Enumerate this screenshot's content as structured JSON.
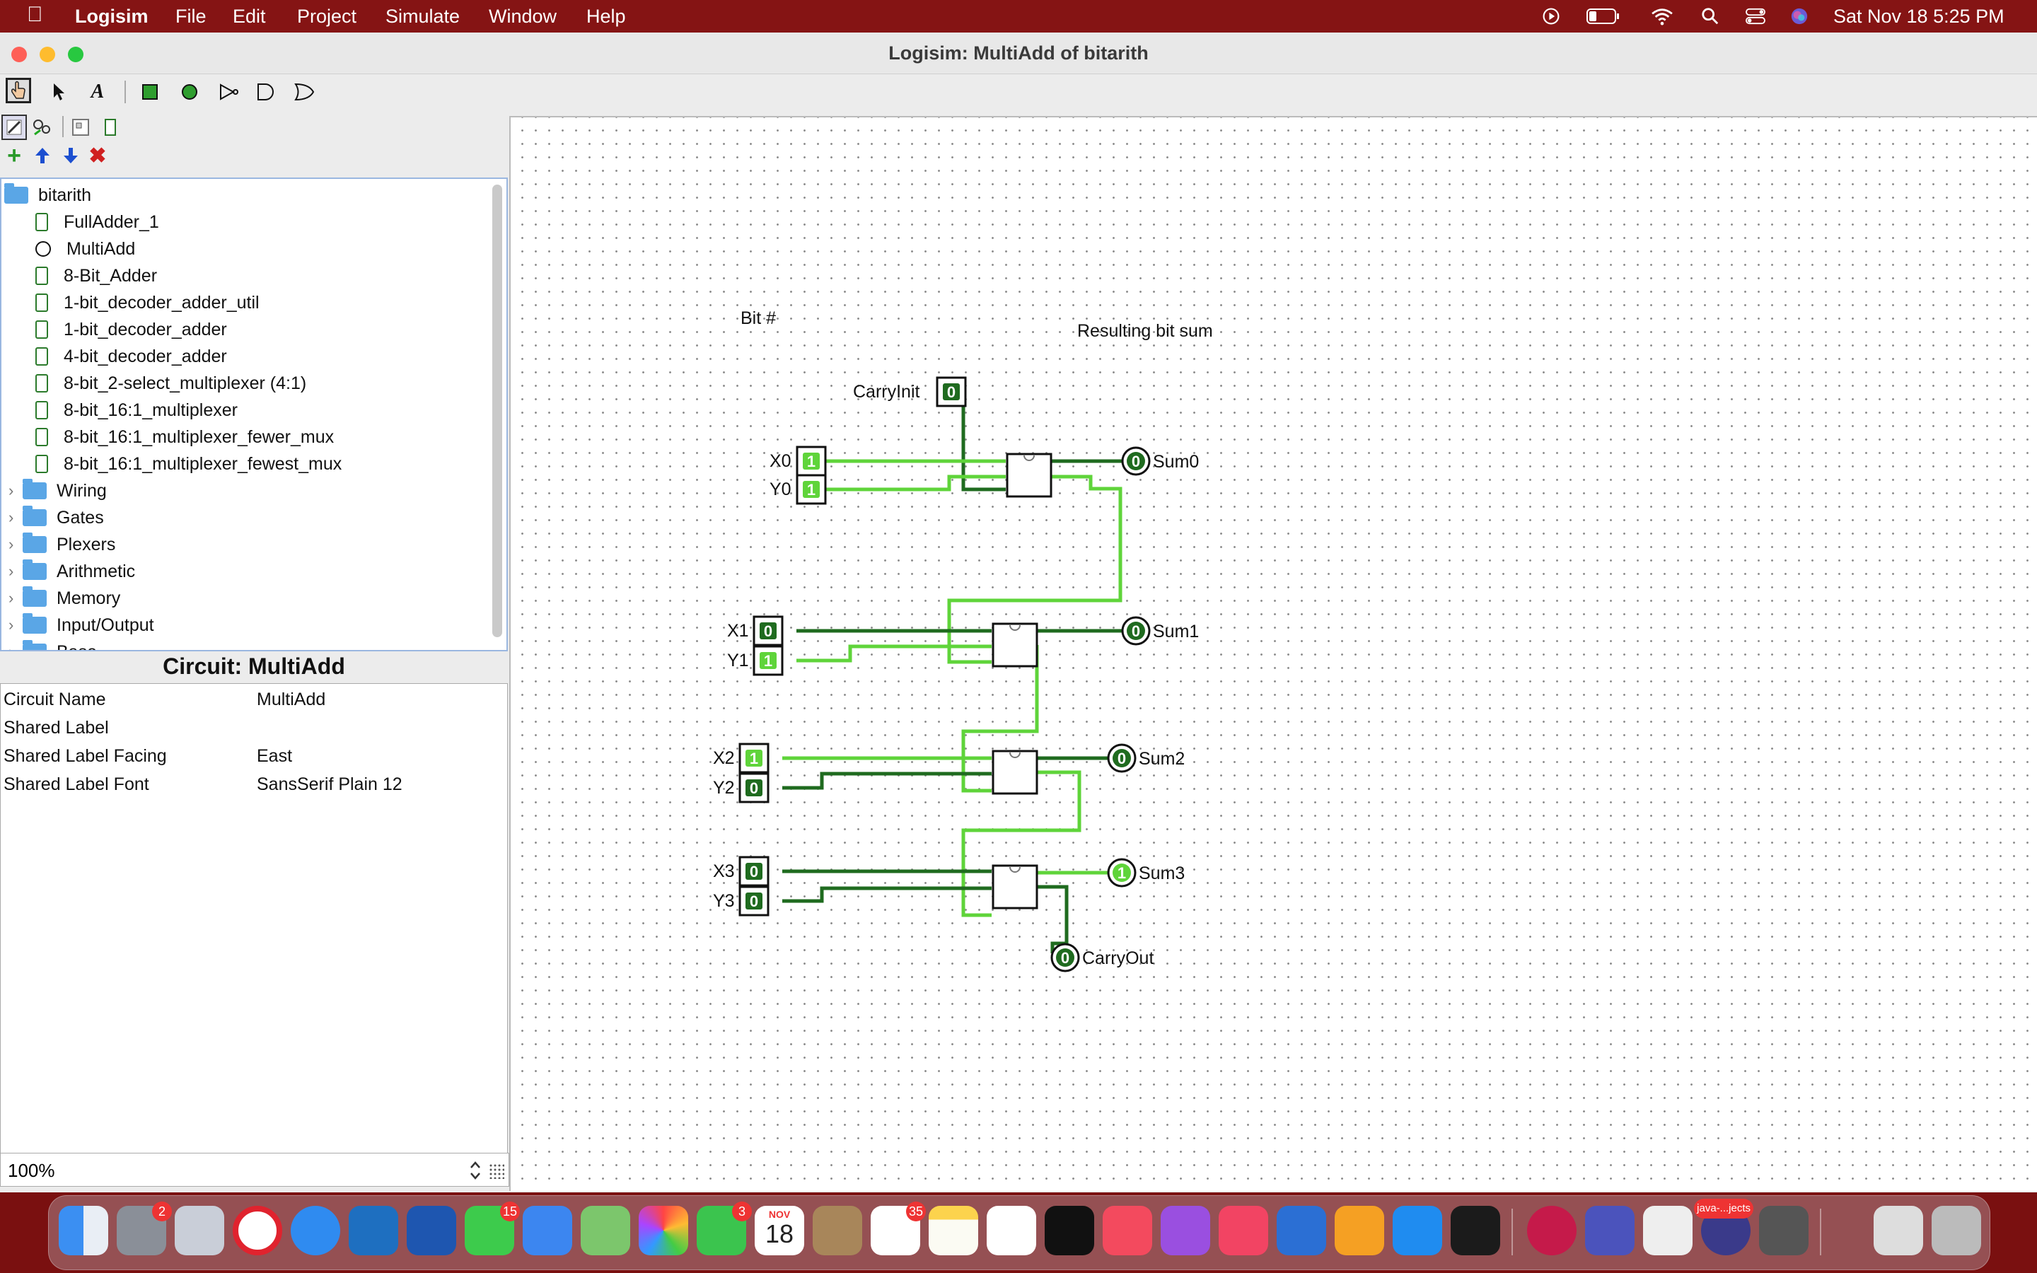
{
  "menubar": {
    "apple": "",
    "app_name": "Logisim",
    "menus": [
      "File",
      "Edit",
      "Project",
      "Simulate",
      "Window",
      "Help"
    ],
    "clock": "Sat Nov 18  5:25 PM"
  },
  "window": {
    "title": "Logisim: MultiAdd of bitarith"
  },
  "explorer": {
    "project": "bitarith",
    "circuits": [
      "FullAdder_1",
      "MultiAdd",
      "8-Bit_Adder",
      "1-bit_decoder_adder_util",
      "1-bit_decoder_adder",
      "4-bit_decoder_adder",
      "8-bit_2-select_multiplexer (4:1)",
      "8-bit_16:1_multiplexer",
      "8-bit_16:1_multiplexer_fewer_mux",
      "8-bit_16:1_multiplexer_fewest_mux"
    ],
    "libraries": [
      "Wiring",
      "Gates",
      "Plexers",
      "Arithmetic",
      "Memory",
      "Input/Output",
      "Base"
    ]
  },
  "attributes": {
    "title": "Circuit: MultiAdd",
    "rows": [
      {
        "name": "Circuit Name",
        "value": "MultiAdd"
      },
      {
        "name": "Shared Label",
        "value": ""
      },
      {
        "name": "Shared Label Facing",
        "value": "East"
      },
      {
        "name": "Shared Label Font",
        "value": "SansSerif Plain 12"
      }
    ]
  },
  "zoom": "100%",
  "circuit": {
    "text_labels": {
      "bit_header": "Bit #",
      "sum_header": "Resulting bit sum"
    },
    "carry_in": {
      "label": "CarryInit",
      "value": "0"
    },
    "inputs": [
      {
        "label": "X0",
        "value": "1"
      },
      {
        "label": "Y0",
        "value": "1"
      },
      {
        "label": "X1",
        "value": "0"
      },
      {
        "label": "Y1",
        "value": "1"
      },
      {
        "label": "X2",
        "value": "1"
      },
      {
        "label": "Y2",
        "value": "0"
      },
      {
        "label": "X3",
        "value": "0"
      },
      {
        "label": "Y3",
        "value": "0"
      }
    ],
    "outputs": [
      {
        "label": "Sum0",
        "value": "0"
      },
      {
        "label": "Sum1",
        "value": "0"
      },
      {
        "label": "Sum2",
        "value": "0"
      },
      {
        "label": "Sum3",
        "value": "1"
      }
    ],
    "carry_out": {
      "label": "CarryOut",
      "value": "0"
    },
    "colors": {
      "wire_high": "#5fd43a",
      "wire_low": "#1f6b1f",
      "pin_high": "#5fd43a",
      "pin_low": "#1f6b1f"
    }
  },
  "dock": {
    "badges": {
      "settings": "2",
      "messages": "15",
      "facetime": "3",
      "reminders": "35"
    },
    "calendar": {
      "month": "NOV",
      "day": "18"
    },
    "java_label": "java-...jects"
  }
}
